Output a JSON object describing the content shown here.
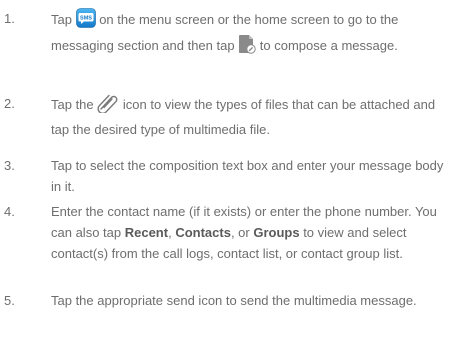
{
  "steps": [
    {
      "number": "1.",
      "parts": {
        "a": "Tap ",
        "b": " on the menu screen or the home screen to go to the messaging section and then tap ",
        "c": " to compose a message."
      }
    },
    {
      "number": "2.",
      "parts": {
        "a": "Tap the ",
        "b": " icon to view the types of files that can be attached and tap the desired type of multimedia file."
      }
    },
    {
      "number": "3.",
      "text": "Tap to select the composition text box and enter your message body in it."
    },
    {
      "number": "4.",
      "parts": {
        "a": "Enter the contact name (if it exists) or enter the phone number. You can also tap ",
        "recent": "Recent",
        "sep1": ", ",
        "contacts": "Contacts",
        "sep2": ", or ",
        "groups": "Groups",
        "b": " to view and select contact(s) from the call logs, contact list, or contact group list."
      }
    },
    {
      "number": "5.",
      "text": "Tap the appropriate send icon to send the multimedia message."
    }
  ],
  "icons": {
    "sms": {
      "label": "SMS",
      "name": "sms-app-icon"
    },
    "compose": {
      "name": "compose-message-icon"
    },
    "attach": {
      "name": "paperclip-icon"
    }
  }
}
